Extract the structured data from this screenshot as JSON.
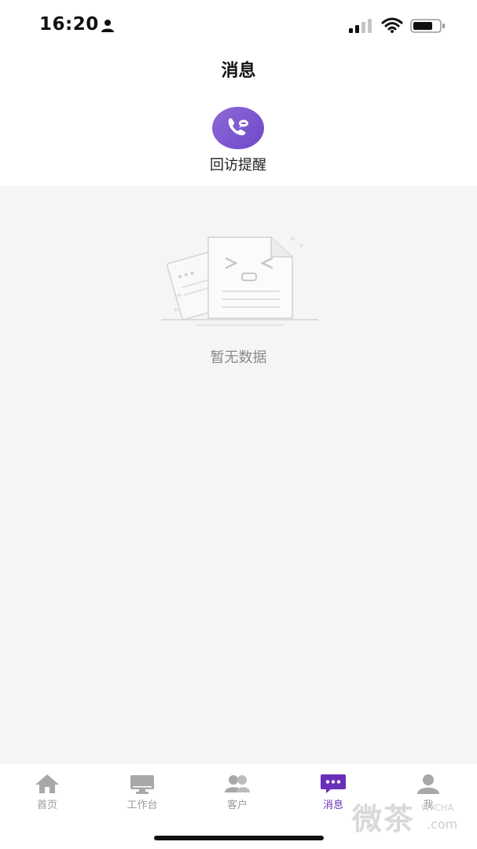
{
  "status_bar": {
    "time": "16:20"
  },
  "header": {
    "title": "消息"
  },
  "quick_entry": {
    "label": "回访提醒",
    "icon": "phone-callback-icon",
    "color": "#7b55d3"
  },
  "empty_state": {
    "text": "暂无数据",
    "icon": "empty-document-icon"
  },
  "tabbar": {
    "active_color": "#6a2fb8",
    "inactive_color": "#9b9b9b",
    "items": [
      {
        "label": "首页",
        "icon": "home-icon"
      },
      {
        "label": "工作台",
        "icon": "monitor-icon"
      },
      {
        "label": "客户",
        "icon": "customers-icon"
      },
      {
        "label": "消息",
        "icon": "chat-icon",
        "active": true
      },
      {
        "label": "我",
        "icon": "profile-icon"
      }
    ]
  },
  "watermark": {
    "text": "微茶",
    "brand": "WXCHA",
    "suffix": ".com"
  }
}
